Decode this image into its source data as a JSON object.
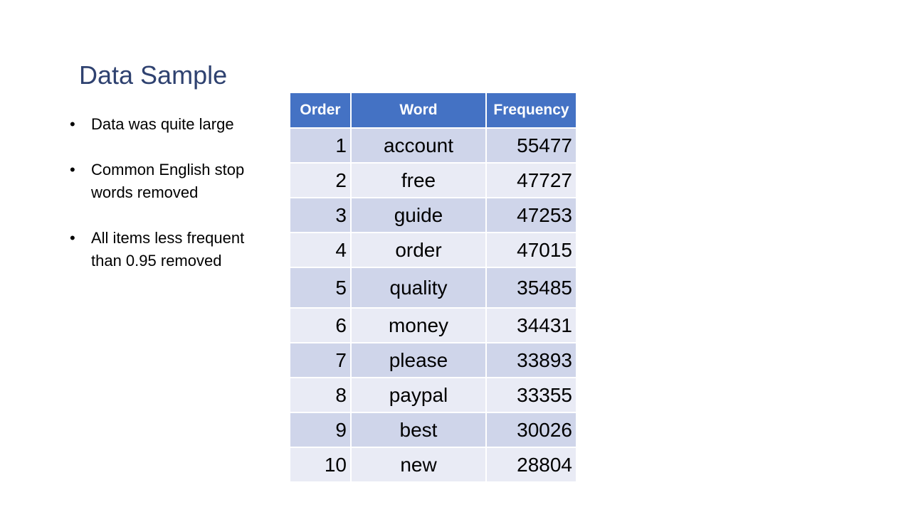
{
  "slide": {
    "title": "Data Sample",
    "bullets": [
      "Data was quite large",
      "Common English stop words removed",
      "All items less frequent than 0.95 removed"
    ]
  },
  "table": {
    "headers": [
      "Order",
      "Word",
      "Frequency"
    ],
    "rows": [
      {
        "order": "1",
        "word": "account",
        "frequency": "55477"
      },
      {
        "order": "2",
        "word": "free",
        "frequency": "47727"
      },
      {
        "order": "3",
        "word": "guide",
        "frequency": "47253"
      },
      {
        "order": "4",
        "word": "order",
        "frequency": "47015"
      },
      {
        "order": "5",
        "word": "quality",
        "frequency": "35485"
      },
      {
        "order": "6",
        "word": "money",
        "frequency": "34431"
      },
      {
        "order": "7",
        "word": "please",
        "frequency": "33893"
      },
      {
        "order": "8",
        "word": "paypal",
        "frequency": "33355"
      },
      {
        "order": "9",
        "word": "best",
        "frequency": "30026"
      },
      {
        "order": "10",
        "word": "new",
        "frequency": "28804"
      }
    ]
  },
  "colors": {
    "title": "#2f4270",
    "header_bg": "#4472c4",
    "row_band_dark": "#cfd5ea",
    "row_band_light": "#e9ebf5"
  }
}
